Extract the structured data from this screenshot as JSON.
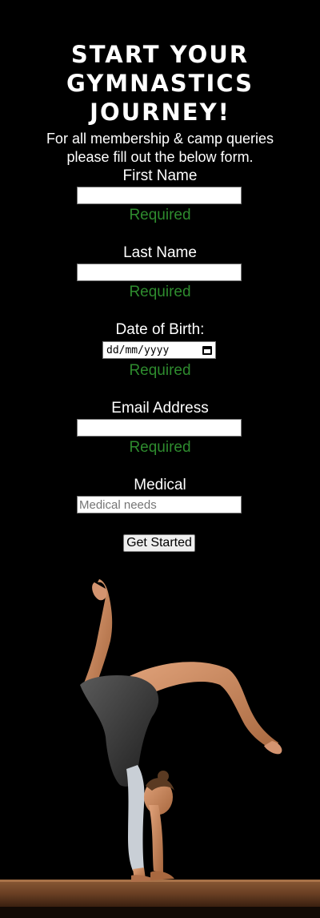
{
  "hero": {
    "title_lines": [
      "Start your",
      "gymnastics",
      "journey!"
    ],
    "intro_lines": [
      "For all membership & camp queries",
      "please fill out the below form."
    ]
  },
  "form": {
    "first_name": {
      "label": "First Name",
      "value": "",
      "validation": "Required"
    },
    "last_name": {
      "label": "Last Name",
      "value": "",
      "validation": "Required"
    },
    "dob": {
      "label": "Date of Birth:",
      "placeholder": "dd/mm/yyyy",
      "validation": "Required"
    },
    "email": {
      "label": "Email Address",
      "value": "",
      "validation": "Required"
    },
    "medical": {
      "label": "Medical",
      "placeholder": "Medical needs",
      "value": ""
    },
    "submit_label": "Get Started"
  },
  "colors": {
    "background": "#000000",
    "text": "#ffffff",
    "validation": "#2e8b2e"
  },
  "icons": [
    "calendar-icon"
  ]
}
